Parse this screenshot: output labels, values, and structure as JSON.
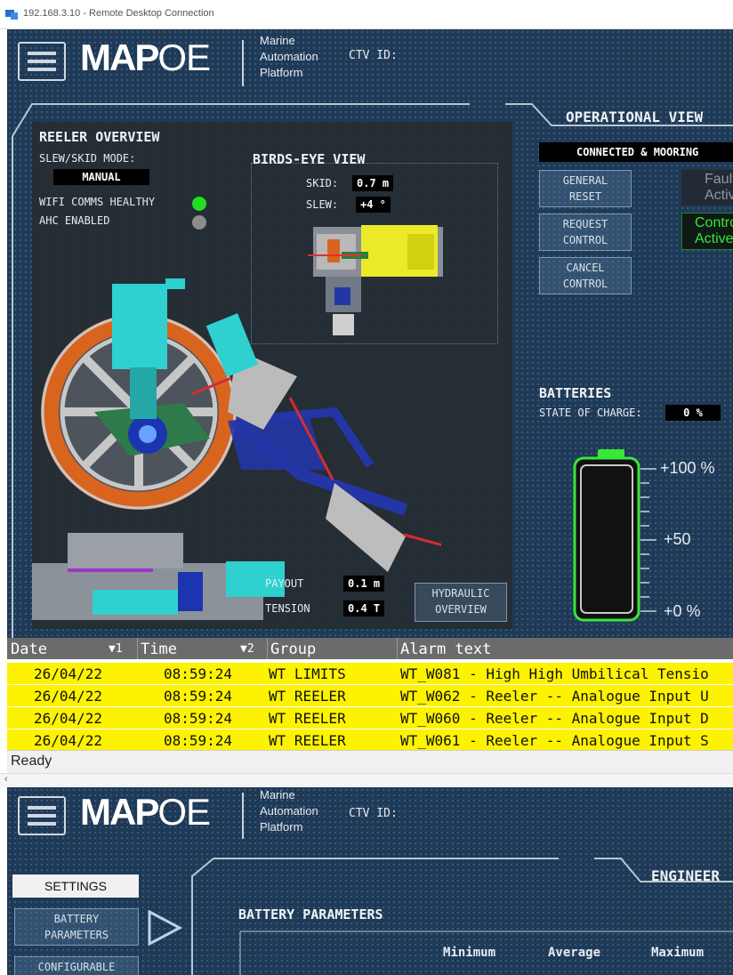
{
  "window": {
    "title": "192.168.3.10 - Remote Desktop Connection"
  },
  "header": {
    "logo_main": "MAP",
    "logo_suffix": "OE",
    "platform_lines": [
      "Marine",
      "Automation",
      "Platform"
    ],
    "ctv_label": "CTV ID:"
  },
  "reeler": {
    "title": "REELER OVERVIEW",
    "slew_mode_label": "SLEW/SKID MODE:",
    "slew_mode_value": "MANUAL",
    "wifi_label": "WIFI COMMS HEALTHY",
    "wifi_status_color": "#22dd22",
    "ahc_label": "AHC ENABLED",
    "ahc_status_color": "#8c8c8c",
    "payout_label": "PAYOUT",
    "payout_value": "0.1 m",
    "tension_label": "TENSION",
    "tension_value": "0.4 T",
    "hydraulic_button": [
      "HYDRAULIC",
      "OVERVIEW"
    ]
  },
  "birds_eye": {
    "title": "BIRDS-EYE VIEW",
    "skid_label": "SKID:",
    "skid_value": "0.7 m",
    "slew_label": "SLEW:",
    "slew_value": "+4 °"
  },
  "operational": {
    "title": "OPERATIONAL VIEW",
    "status": "CONNECTED & MOORING",
    "general_reset": [
      "GENERAL",
      "RESET"
    ],
    "request_control": [
      "REQUEST",
      "CONTROL"
    ],
    "cancel_control": [
      "CANCEL",
      "CONTROL"
    ],
    "fault_text": [
      "Fault",
      "Active"
    ],
    "control_text": [
      "Control",
      "Active"
    ]
  },
  "batteries": {
    "title": "BATTERIES",
    "soc_label": "STATE OF CHARGE:",
    "soc_value": "0 %",
    "level_fraction": 0,
    "scale_100": "+100 %",
    "scale_50": "+50",
    "scale_0": "+0 %"
  },
  "alarms": {
    "headers": {
      "date": "Date",
      "date_sort": "▼1",
      "time": "Time",
      "time_sort": "▼2",
      "group": "Group",
      "text": "Alarm text"
    },
    "rows": [
      {
        "date": "26/04/22",
        "time": "08:59:24",
        "group": "WT LIMITS",
        "text": "WT_W081 - High High Umbilical Tensio"
      },
      {
        "date": "26/04/22",
        "time": "08:59:24",
        "group": "WT REELER",
        "text": "WT_W062 - Reeler -- Analogue Input U"
      },
      {
        "date": "26/04/22",
        "time": "08:59:24",
        "group": "WT REELER",
        "text": "WT_W060 - Reeler -- Analogue Input D"
      },
      {
        "date": "26/04/22",
        "time": "08:59:24",
        "group": "WT REELER",
        "text": "WT_W061 - Reeler -- Analogue Input S"
      }
    ],
    "row_color": "#fdf200"
  },
  "status_bar": {
    "text": "Ready"
  },
  "scroll_arrow": "‹",
  "second": {
    "settings_label": "SETTINGS",
    "battery_params_button": [
      "BATTERY",
      "PARAMETERS"
    ],
    "configurable_button": "CONFIGURABLE",
    "engineer_title": "ENGINEER",
    "battery_params_title": "BATTERY PARAMETERS",
    "columns": [
      "Minimum",
      "Average",
      "Maximum"
    ]
  },
  "colors": {
    "panel_bg": "#1f3a56",
    "accent_cyan": "#2fd0d0",
    "battery_green": "#39e639"
  }
}
